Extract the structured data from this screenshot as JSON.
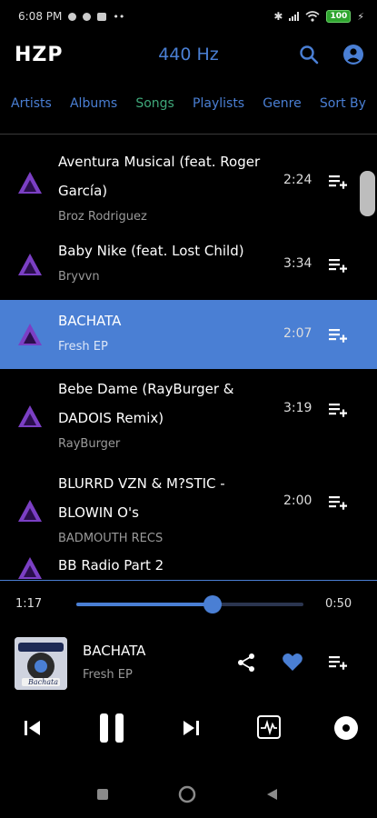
{
  "status_bar": {
    "time": "6:08 PM",
    "battery": "100"
  },
  "header": {
    "logo": "HZP",
    "frequency": "440 Hz"
  },
  "tabs": [
    {
      "label": "Artists",
      "active": false
    },
    {
      "label": "Albums",
      "active": false
    },
    {
      "label": "Songs",
      "active": true
    },
    {
      "label": "Playlists",
      "active": false
    },
    {
      "label": "Genre",
      "active": false
    },
    {
      "label": "Sort By",
      "active": false
    }
  ],
  "songs": [
    {
      "title_line1": "Aventura Musical (feat. Roger",
      "title_line2": "García)",
      "artist": "Broz Rodriguez",
      "duration": "2:24",
      "selected": false
    },
    {
      "title_line1": "Baby Nike (feat. Lost Child)",
      "title_line2": "",
      "artist": "Bryvvn",
      "duration": "3:34",
      "selected": false
    },
    {
      "title_line1": "BACHATA",
      "title_line2": "",
      "artist": "Fresh EP",
      "duration": "2:07",
      "selected": true
    },
    {
      "title_line1": "Bebe Dame (RayBurger &",
      "title_line2": "DADOIS Remix)",
      "artist": "RayBurger",
      "duration": "3:19",
      "selected": false
    },
    {
      "title_line1": "BLURRD VZN & M?STIC -",
      "title_line2": "BLOWIN O's",
      "artist": "BADMOUTH RECS",
      "duration": "2:00",
      "selected": false
    },
    {
      "title_line1": "BB Radio Part 2",
      "title_line2": "",
      "artist": "",
      "duration": "",
      "selected": false
    }
  ],
  "player": {
    "elapsed": "1:17",
    "remaining": "0:50",
    "progress": 0.6,
    "title": "BACHATA",
    "subtitle": "Fresh EP",
    "cover_text": "Bachata",
    "favorite": true
  },
  "colors": {
    "accent": "#4a7fd4",
    "active_tab": "#3fa87a",
    "art_purple": "#7b3fc4",
    "background": "#000000"
  },
  "icons": [
    "search-icon",
    "account-icon",
    "playlist-add-icon",
    "share-icon",
    "heart-icon",
    "skip-previous-icon",
    "pause-icon",
    "skip-next-icon",
    "equalizer-icon",
    "disc-icon"
  ]
}
